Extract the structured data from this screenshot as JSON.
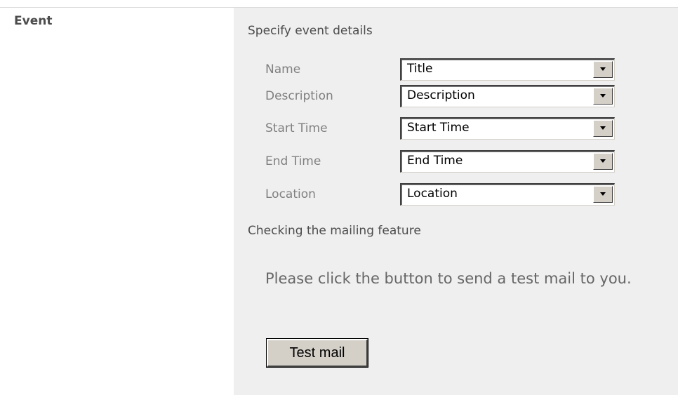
{
  "section": {
    "label": "Event"
  },
  "event_details": {
    "title": "Specify event details",
    "fields": [
      {
        "label": "Name",
        "value": "Title"
      },
      {
        "label": "Description",
        "value": "Description"
      },
      {
        "label": "Start Time",
        "value": "Start Time"
      },
      {
        "label": "End Time",
        "value": "End Time"
      },
      {
        "label": "Location",
        "value": "Location"
      }
    ]
  },
  "mailing": {
    "title": "Checking the mailing feature",
    "instruction": "Please click the button to send a test mail to you.",
    "button_label": "Test mail"
  },
  "colors": {
    "panel_background": "#efefef",
    "label_text": "#808080",
    "heading_text": "#4c4c4c",
    "button_face": "#d4d0c8"
  },
  "icons": {
    "dropdown": "chevron-down-icon"
  }
}
